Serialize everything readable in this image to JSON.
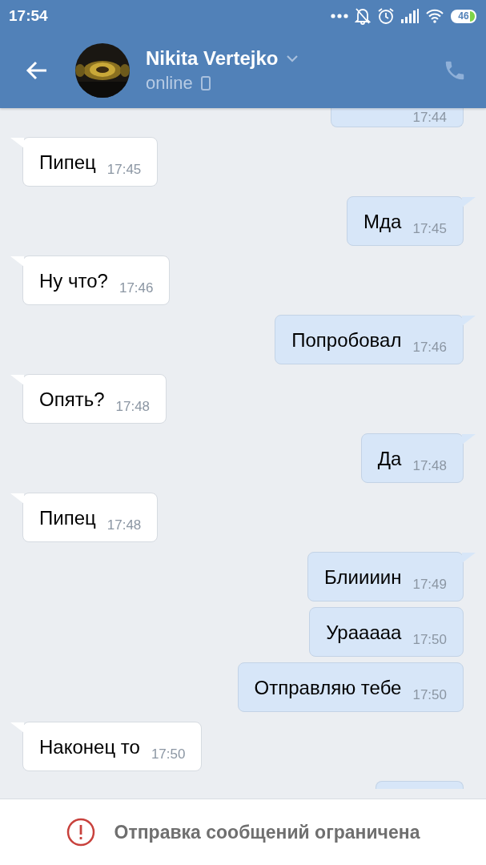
{
  "status_bar": {
    "time": "17:54",
    "battery": "46"
  },
  "header": {
    "name": "Nikita Vertejko",
    "status": "online"
  },
  "messages": [
    {
      "kind": "out",
      "cut": true,
      "time": "17:44"
    },
    {
      "kind": "in",
      "text": "Пипец",
      "time": "17:45"
    },
    {
      "kind": "out",
      "text": "Мда",
      "time": "17:45"
    },
    {
      "kind": "in",
      "text": "Ну что?",
      "time": "17:46"
    },
    {
      "kind": "out",
      "text": "Попробовал",
      "time": "17:46"
    },
    {
      "kind": "in",
      "text": "Опять?",
      "time": "17:48"
    },
    {
      "kind": "out",
      "text": "Да",
      "time": "17:48"
    },
    {
      "kind": "in",
      "text": "Пипец",
      "time": "17:48"
    },
    {
      "kind": "out",
      "text": "Блиииин",
      "time": "17:49"
    },
    {
      "kind": "out",
      "text": "Урааааа",
      "time": "17:50"
    },
    {
      "kind": "out",
      "text": "Отправляю тебе",
      "time": "17:50"
    },
    {
      "kind": "in",
      "text": "Наконец то",
      "time": "17:50"
    },
    {
      "kind": "out",
      "cut": true
    }
  ],
  "notice": {
    "text": "Отправка сообщений ограничена"
  }
}
